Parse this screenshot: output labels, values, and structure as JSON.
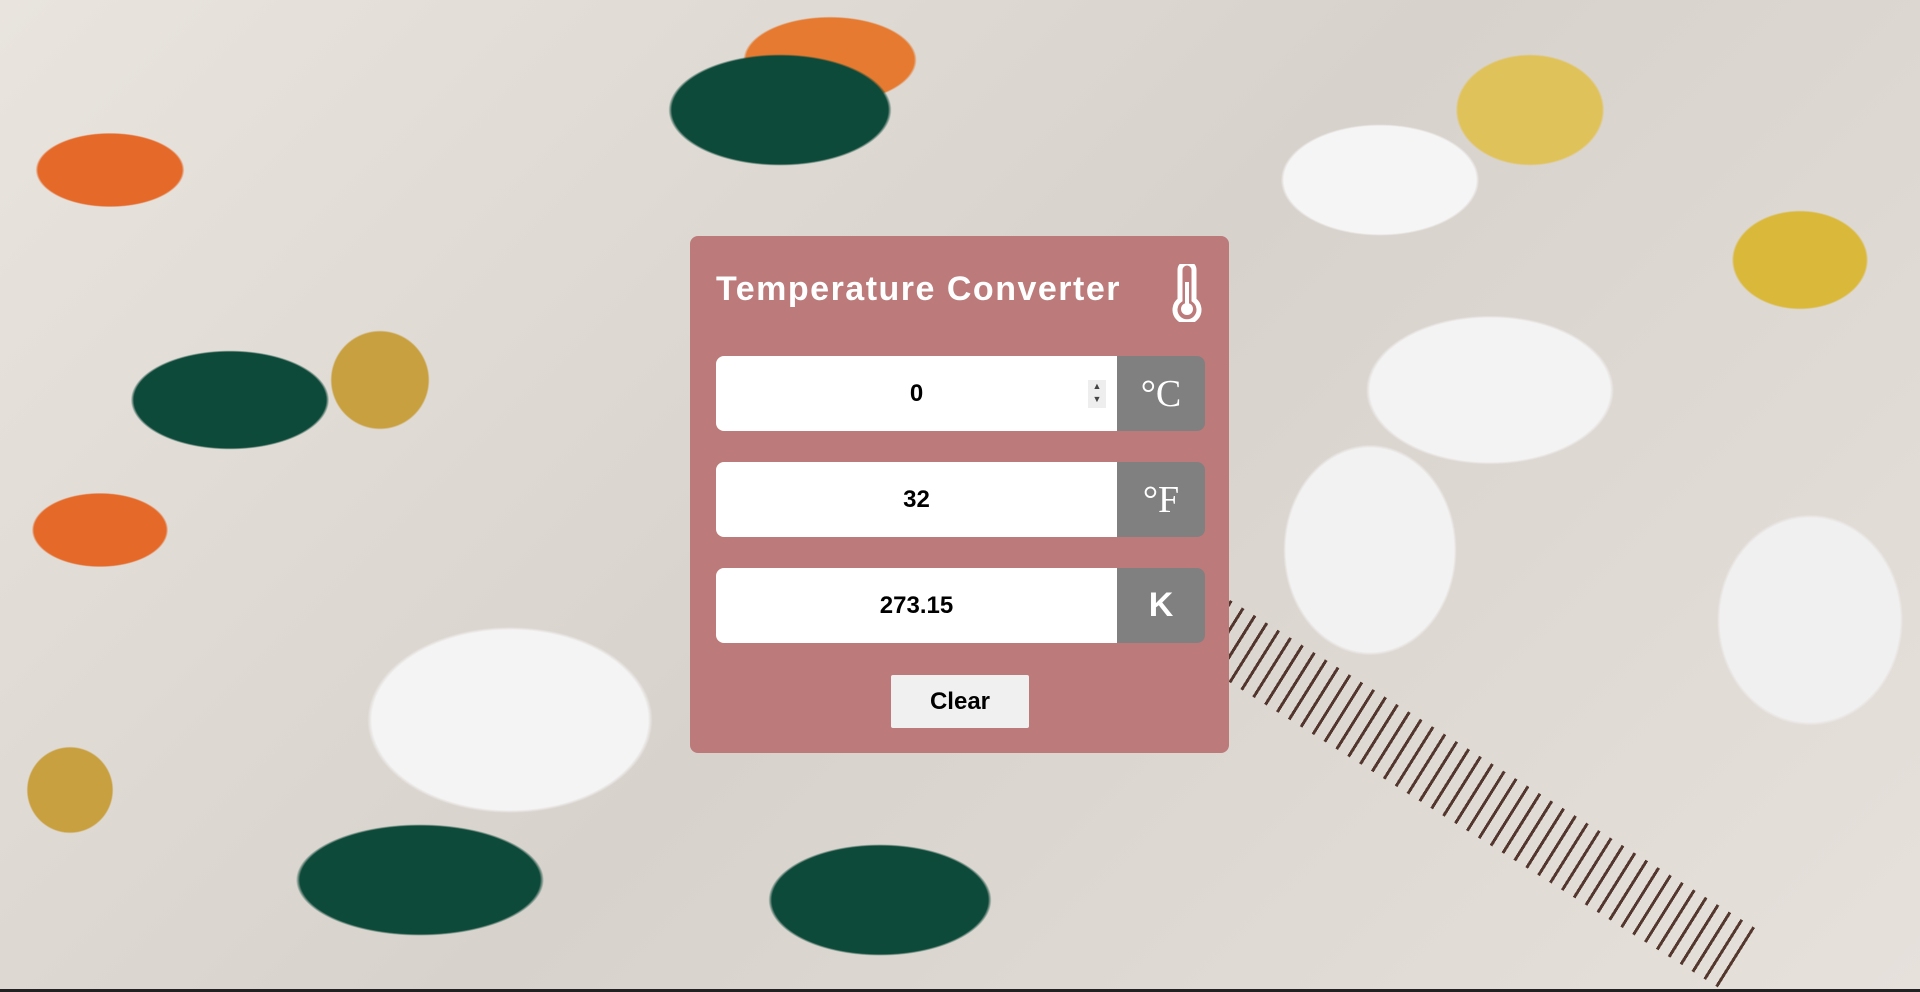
{
  "title": "Temperature Converter",
  "fields": [
    {
      "value": "0",
      "unit": "°C"
    },
    {
      "value": "32",
      "unit": "°F"
    },
    {
      "value": "273.15",
      "unit": "K"
    }
  ],
  "clear_label": "Clear",
  "colors": {
    "card": "#bc7a7a",
    "unit_bg": "#808080"
  }
}
